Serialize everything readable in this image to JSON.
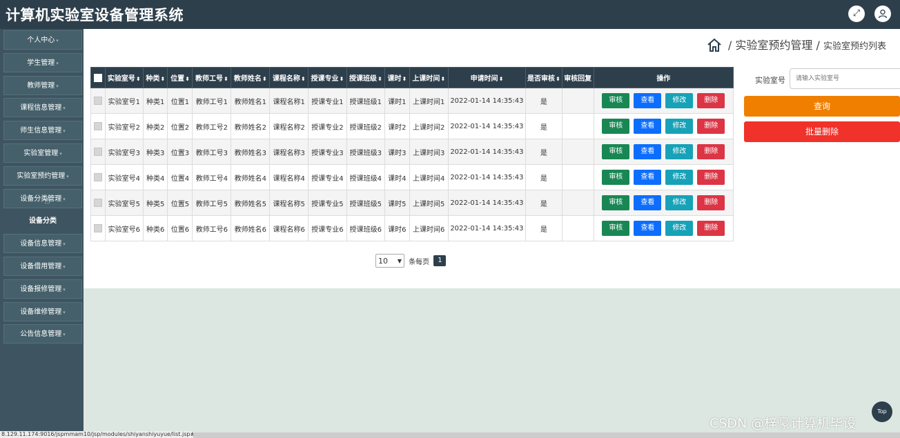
{
  "app": {
    "title": "计算机实验室设备管理系统"
  },
  "header_icons": [
    "fullscreen-icon",
    "user-icon"
  ],
  "sidebar": {
    "items": [
      {
        "label": "个人中心",
        "caret": "▾"
      },
      {
        "label": "学生管理",
        "caret": "▾"
      },
      {
        "label": "教师管理",
        "caret": "▾"
      },
      {
        "label": "课程信息管理",
        "caret": "▾"
      },
      {
        "label": "师生信息管理",
        "caret": "▾"
      },
      {
        "label": "实验室管理",
        "caret": "▾"
      },
      {
        "label": "实验室预约管理",
        "caret": "▾"
      },
      {
        "label": "设备分类管理",
        "caret": "▾"
      },
      {
        "label": "设备分类",
        "caret": ""
      },
      {
        "label": "设备信息管理",
        "caret": "▾"
      },
      {
        "label": "设备借用管理",
        "caret": "▾"
      },
      {
        "label": "设备报修管理",
        "caret": "▾"
      },
      {
        "label": "设备维修管理",
        "caret": "▾"
      },
      {
        "label": "公告信息管理",
        "caret": "▾"
      }
    ]
  },
  "breadcrumb": {
    "sep": "/",
    "level1": "实验室预约管理",
    "level2": "实验室预约列表"
  },
  "table": {
    "sort_glyph": "⬍",
    "columns": [
      "实验室号",
      "种类",
      "位置",
      "教师工号",
      "教师姓名",
      "课程名称",
      "授课专业",
      "授课班级",
      "课时",
      "上课时间",
      "申请时间",
      "是否审核",
      "审核回复",
      "操作"
    ],
    "sortable": [
      true,
      true,
      true,
      true,
      true,
      true,
      true,
      true,
      true,
      true,
      true,
      true,
      false,
      false
    ],
    "actions": {
      "audit": "审核",
      "view": "查看",
      "edit": "修改",
      "delete": "删除"
    },
    "rows": [
      [
        "实验室号1",
        "种类1",
        "位置1",
        "教师工号1",
        "教师姓名1",
        "课程名称1",
        "授课专业1",
        "授课班级1",
        "课时1",
        "上课时间1",
        "2022-01-14 14:35:43",
        "是",
        ""
      ],
      [
        "实验室号2",
        "种类2",
        "位置2",
        "教师工号2",
        "教师姓名2",
        "课程名称2",
        "授课专业2",
        "授课班级2",
        "课时2",
        "上课时间2",
        "2022-01-14 14:35:43",
        "是",
        ""
      ],
      [
        "实验室号3",
        "种类3",
        "位置3",
        "教师工号3",
        "教师姓名3",
        "课程名称3",
        "授课专业3",
        "授课班级3",
        "课时3",
        "上课时间3",
        "2022-01-14 14:35:43",
        "是",
        ""
      ],
      [
        "实验室号4",
        "种类4",
        "位置4",
        "教师工号4",
        "教师姓名4",
        "课程名称4",
        "授课专业4",
        "授课班级4",
        "课时4",
        "上课时间4",
        "2022-01-14 14:35:43",
        "是",
        ""
      ],
      [
        "实验室号5",
        "种类5",
        "位置5",
        "教师工号5",
        "教师姓名5",
        "课程名称5",
        "授课专业5",
        "授课班级5",
        "课时5",
        "上课时间5",
        "2022-01-14 14:35:43",
        "是",
        ""
      ],
      [
        "实验室号6",
        "种类6",
        "位置6",
        "教师工号6",
        "教师姓名6",
        "课程名称6",
        "授课专业6",
        "授课班级6",
        "课时6",
        "上课时间6",
        "2022-01-14 14:35:43",
        "是",
        ""
      ]
    ]
  },
  "pagination": {
    "page_size": "10",
    "per_page_label": "条每页",
    "current_page": "1"
  },
  "search": {
    "label": "实验室号",
    "placeholder": "请输入实验室号",
    "query_button": "查询",
    "batch_delete_button": "批量删除"
  },
  "top_button": "Top",
  "status_url": "8.129.11.174:9016/jspmmam10/jsp/modules/shiyanshiyuyue/list.jsp#",
  "watermark": "CSDN @梓豪计算机毕设",
  "colors": {
    "header": "#2e3f4c",
    "sidebar": "#3e5460",
    "audit": "#198754",
    "view": "#0d6efd",
    "edit": "#17a2b8",
    "delete": "#dc3545",
    "query": "#f07f00",
    "batch_delete": "#f0322a"
  }
}
